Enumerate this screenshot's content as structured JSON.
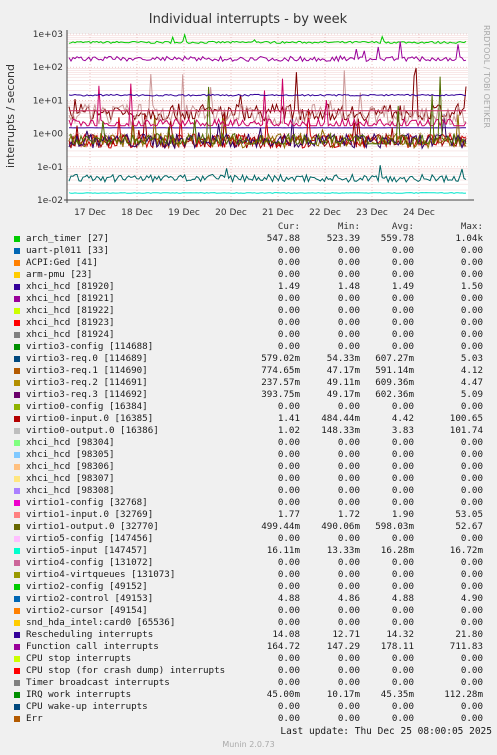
{
  "chart_data": {
    "type": "line",
    "title": "Individual interrupts - by week",
    "ylabel": "interrupts / second",
    "yscale": "log",
    "ylim": [
      0.01,
      1000
    ],
    "yticks": [
      "1e-02",
      "1e-01",
      "1e+00",
      "1e+01",
      "1e+02",
      "1e+03"
    ],
    "xticks": [
      "17 Dec",
      "18 Dec",
      "19 Dec",
      "20 Dec",
      "21 Dec",
      "22 Dec",
      "23 Dec",
      "24 Dec"
    ],
    "grid": true,
    "side_label": "RRDTOOL / TOBI OETIKER",
    "series": [
      {
        "name": "arch_timer [27]",
        "color": "#00cc00",
        "values": [
          547.88,
          523.39,
          559.78,
          1040
        ]
      },
      {
        "name": "xhci_hcd [81920]",
        "color": "#330099",
        "values": [
          1.49,
          1.48,
          1.49,
          1.5
        ]
      },
      {
        "name": "virtio3-req.0 [114689]",
        "color": "#cc0000",
        "values": [
          0.579,
          0.0543,
          0.607,
          5.03
        ]
      },
      {
        "name": "virtio3-req.1 [114690]",
        "color": "#990000",
        "values": [
          0.775,
          0.0472,
          0.591,
          4.12
        ]
      },
      {
        "name": "virtio3-req.2 [114691]",
        "color": "#8f6c00",
        "values": [
          0.2376,
          0.0491,
          0.609,
          4.47
        ]
      },
      {
        "name": "virtio3-req.3 [114692]",
        "color": "#330066",
        "values": [
          0.3938,
          0.0492,
          0.602,
          5.09
        ]
      },
      {
        "name": "virtio0-input.0 [16385]",
        "color": "#800000",
        "values": [
          1.41,
          0.484,
          4.42,
          100.65
        ]
      },
      {
        "name": "virtio0-output.0 [16386]",
        "color": "#cc9999",
        "values": [
          1.02,
          0.148,
          3.83,
          101.74
        ]
      },
      {
        "name": "virtio1-input.0 [32769]",
        "color": "#cc0066",
        "values": [
          1.77,
          1.72,
          1.9,
          53.05
        ]
      },
      {
        "name": "virtio1-output.0 [32770]",
        "color": "#4f6c00",
        "values": [
          0.4994,
          0.4901,
          0.598,
          52.67
        ]
      },
      {
        "name": "virtio5-input [147457]",
        "color": "#00e6cc",
        "values": [
          0.0161,
          0.0133,
          0.0163,
          0.0167
        ]
      },
      {
        "name": "virtio2-control [49153]",
        "color": "#cc3366",
        "values": [
          4.88,
          4.86,
          4.88,
          4.9
        ]
      },
      {
        "name": "Rescheduling interrupts",
        "color": "#330099",
        "values": [
          14.08,
          12.71,
          14.32,
          21.8
        ]
      },
      {
        "name": "Function call interrupts",
        "color": "#990099",
        "values": [
          164.72,
          147.29,
          178.11,
          711.83
        ]
      },
      {
        "name": "IRQ work interrupts",
        "color": "#006666",
        "values": [
          0.045,
          0.01017,
          0.04535,
          0.11228
        ]
      }
    ]
  },
  "legend": {
    "headers": [
      "Cur:",
      "Min:",
      "Avg:",
      "Max:"
    ],
    "rows": [
      {
        "name": "arch_timer [27]",
        "color": "#00cc00",
        "cur": "547.88",
        "min": "523.39",
        "avg": "559.78",
        "max": "1.04k"
      },
      {
        "name": "uart-pl011 [33]",
        "color": "#0066b3",
        "cur": "0.00",
        "min": "0.00",
        "avg": "0.00",
        "max": "0.00"
      },
      {
        "name": "ACPI:Ged [41]",
        "color": "#ff8000",
        "cur": "0.00",
        "min": "0.00",
        "avg": "0.00",
        "max": "0.00"
      },
      {
        "name": "arm-pmu [23]",
        "color": "#ffcc00",
        "cur": "0.00",
        "min": "0.00",
        "avg": "0.00",
        "max": "0.00"
      },
      {
        "name": "xhci_hcd [81920]",
        "color": "#330099",
        "cur": "1.49",
        "min": "1.48",
        "avg": "1.49",
        "max": "1.50"
      },
      {
        "name": "xhci_hcd [81921]",
        "color": "#990099",
        "cur": "0.00",
        "min": "0.00",
        "avg": "0.00",
        "max": "0.00"
      },
      {
        "name": "xhci_hcd [81922]",
        "color": "#ccff00",
        "cur": "0.00",
        "min": "0.00",
        "avg": "0.00",
        "max": "0.00"
      },
      {
        "name": "xhci_hcd [81923]",
        "color": "#ff0000",
        "cur": "0.00",
        "min": "0.00",
        "avg": "0.00",
        "max": "0.00"
      },
      {
        "name": "xhci_hcd [81924]",
        "color": "#808080",
        "cur": "0.00",
        "min": "0.00",
        "avg": "0.00",
        "max": "0.00"
      },
      {
        "name": "virtio3-config [114688]",
        "color": "#008f00",
        "cur": "0.00",
        "min": "0.00",
        "avg": "0.00",
        "max": "0.00"
      },
      {
        "name": "virtio3-req.0 [114689]",
        "color": "#00487d",
        "cur": "579.02m",
        "min": "54.33m",
        "avg": "607.27m",
        "max": "5.03"
      },
      {
        "name": "virtio3-req.1 [114690]",
        "color": "#b35a00",
        "cur": "774.65m",
        "min": "47.17m",
        "avg": "591.14m",
        "max": "4.12"
      },
      {
        "name": "virtio3-req.2 [114691]",
        "color": "#b38f00",
        "cur": "237.57m",
        "min": "49.11m",
        "avg": "609.36m",
        "max": "4.47"
      },
      {
        "name": "virtio3-req.3 [114692]",
        "color": "#6b006b",
        "cur": "393.75m",
        "min": "49.17m",
        "avg": "602.36m",
        "max": "5.09"
      },
      {
        "name": "virtio0-config [16384]",
        "color": "#8fb300",
        "cur": "0.00",
        "min": "0.00",
        "avg": "0.00",
        "max": "0.00"
      },
      {
        "name": "virtio0-input.0 [16385]",
        "color": "#b30000",
        "cur": "1.41",
        "min": "484.44m",
        "avg": "4.42",
        "max": "100.65"
      },
      {
        "name": "virtio0-output.0 [16386]",
        "color": "#bebebe",
        "cur": "1.02",
        "min": "148.33m",
        "avg": "3.83",
        "max": "101.74"
      },
      {
        "name": "xhci_hcd [98304]",
        "color": "#80ff80",
        "cur": "0.00",
        "min": "0.00",
        "avg": "0.00",
        "max": "0.00"
      },
      {
        "name": "xhci_hcd [98305]",
        "color": "#80c9ff",
        "cur": "0.00",
        "min": "0.00",
        "avg": "0.00",
        "max": "0.00"
      },
      {
        "name": "xhci_hcd [98306]",
        "color": "#ffc080",
        "cur": "0.00",
        "min": "0.00",
        "avg": "0.00",
        "max": "0.00"
      },
      {
        "name": "xhci_hcd [98307]",
        "color": "#ffe680",
        "cur": "0.00",
        "min": "0.00",
        "avg": "0.00",
        "max": "0.00"
      },
      {
        "name": "xhci_hcd [98308]",
        "color": "#aa80ff",
        "cur": "0.00",
        "min": "0.00",
        "avg": "0.00",
        "max": "0.00"
      },
      {
        "name": "virtio1-config [32768]",
        "color": "#ee00cc",
        "cur": "0.00",
        "min": "0.00",
        "avg": "0.00",
        "max": "0.00"
      },
      {
        "name": "virtio1-input.0 [32769]",
        "color": "#ff8080",
        "cur": "1.77",
        "min": "1.72",
        "avg": "1.90",
        "max": "53.05"
      },
      {
        "name": "virtio1-output.0 [32770]",
        "color": "#666600",
        "cur": "499.44m",
        "min": "490.06m",
        "avg": "598.03m",
        "max": "52.67"
      },
      {
        "name": "virtio5-config [147456]",
        "color": "#ffbfff",
        "cur": "0.00",
        "min": "0.00",
        "avg": "0.00",
        "max": "0.00"
      },
      {
        "name": "virtio5-input [147457]",
        "color": "#00ffcc",
        "cur": "16.11m",
        "min": "13.33m",
        "avg": "16.28m",
        "max": "16.72m"
      },
      {
        "name": "virtio4-config [131072]",
        "color": "#cc6699",
        "cur": "0.00",
        "min": "0.00",
        "avg": "0.00",
        "max": "0.00"
      },
      {
        "name": "virtio4-virtqueues [131073]",
        "color": "#999900",
        "cur": "0.00",
        "min": "0.00",
        "avg": "0.00",
        "max": "0.00"
      },
      {
        "name": "virtio2-config [49152]",
        "color": "#00cc00",
        "cur": "0.00",
        "min": "0.00",
        "avg": "0.00",
        "max": "0.00"
      },
      {
        "name": "virtio2-control [49153]",
        "color": "#0066b3",
        "cur": "4.88",
        "min": "4.86",
        "avg": "4.88",
        "max": "4.90"
      },
      {
        "name": "virtio2-cursor [49154]",
        "color": "#ff8000",
        "cur": "0.00",
        "min": "0.00",
        "avg": "0.00",
        "max": "0.00"
      },
      {
        "name": "snd_hda_intel:card0 [65536]",
        "color": "#ffcc00",
        "cur": "0.00",
        "min": "0.00",
        "avg": "0.00",
        "max": "0.00"
      },
      {
        "name": "Rescheduling interrupts",
        "color": "#330099",
        "cur": "14.08",
        "min": "12.71",
        "avg": "14.32",
        "max": "21.80"
      },
      {
        "name": "Function call interrupts",
        "color": "#990099",
        "cur": "164.72",
        "min": "147.29",
        "avg": "178.11",
        "max": "711.83"
      },
      {
        "name": "CPU stop interrupts",
        "color": "#ccff00",
        "cur": "0.00",
        "min": "0.00",
        "avg": "0.00",
        "max": "0.00"
      },
      {
        "name": "CPU stop (for crash dump) interrupts",
        "color": "#ff0000",
        "cur": "0.00",
        "min": "0.00",
        "avg": "0.00",
        "max": "0.00"
      },
      {
        "name": "Timer broadcast interrupts",
        "color": "#808080",
        "cur": "0.00",
        "min": "0.00",
        "avg": "0.00",
        "max": "0.00"
      },
      {
        "name": "IRQ work interrupts",
        "color": "#008f00",
        "cur": "45.00m",
        "min": "10.17m",
        "avg": "45.35m",
        "max": "112.28m"
      },
      {
        "name": "CPU wake-up interrupts",
        "color": "#00487d",
        "cur": "0.00",
        "min": "0.00",
        "avg": "0.00",
        "max": "0.00"
      },
      {
        "name": "Err",
        "color": "#b35a00",
        "cur": "0.00",
        "min": "0.00",
        "avg": "0.00",
        "max": "0.00"
      }
    ]
  },
  "footer": {
    "last_update": "Last update: Thu Dec 25 08:00:05 2025",
    "brand": "Munin 2.0.73"
  }
}
